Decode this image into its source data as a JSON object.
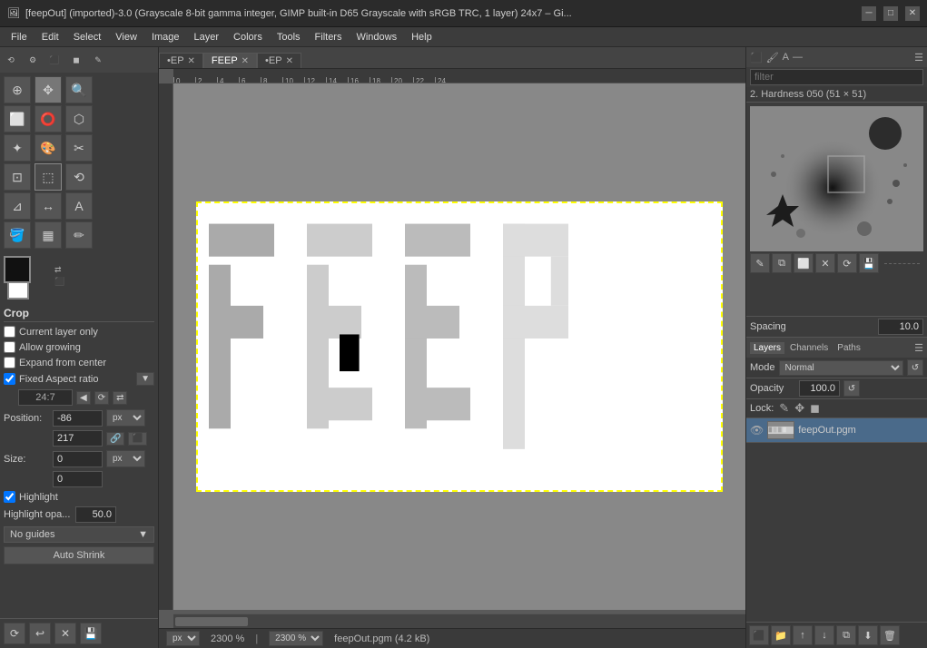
{
  "window": {
    "title": "[feepOut] (imported)-3.0 (Grayscale 8-bit gamma integer, GIMP built-in D65 Grayscale with sRGB TRC, 1 layer) 24x7 – Gi...",
    "minimize": "─",
    "restore": "□",
    "close": "✕",
    "icon": "🖼"
  },
  "menubar": {
    "items": [
      "File",
      "Edit",
      "Select",
      "View",
      "Image",
      "Layer",
      "Colors",
      "Tools",
      "Filters",
      "Windows",
      "Help"
    ]
  },
  "image_tabs": [
    {
      "label": "•EP",
      "active": false
    },
    {
      "label": "FEEP",
      "active": true
    },
    {
      "label": "•EP",
      "active": false
    }
  ],
  "tools": {
    "grid": [
      "⊕",
      "⬡",
      "⌀",
      "✎",
      "✂",
      "⊡",
      "⟲",
      "★",
      "→",
      "⬛",
      "✏",
      "⬚",
      "🖋",
      "✦",
      "A",
      "🔍"
    ]
  },
  "crop_options": {
    "section_title": "Crop",
    "current_layer_only": "Current layer only",
    "allow_growing": "Allow growing",
    "expand_from_center": "Expand from center",
    "fixed_aspect_ratio": "Fixed Aspect ratio",
    "crop_ratio": "24:7",
    "position_label": "Position:",
    "position_unit": "px",
    "position_x": "-86",
    "position_y": "217",
    "size_label": "Size:",
    "size_unit": "px",
    "size_x": "0",
    "size_y": "0",
    "highlight_label": "Highlight",
    "highlight_opa_label": "Highlight opa...",
    "highlight_opa_value": "50.0",
    "guides_label": "No guides",
    "auto_shrink_label": "Auto Shrink"
  },
  "canvas": {
    "zoom_level": "2300 %",
    "zoom_unit": "px",
    "filename": "feepOut.pgm (4.2 kB)"
  },
  "brush_panel": {
    "name_label": "2. Hardness 050 (51 × 51)",
    "filter_placeholder": "filter",
    "spacing_label": "Spacing",
    "spacing_value": "10.0"
  },
  "layers_panel": {
    "tabs": [
      "Layers",
      "Channels",
      "Paths"
    ],
    "active_tab": "Layers",
    "mode_label": "Mode",
    "mode_value": "Normal",
    "opacity_label": "Opacity",
    "opacity_value": "100.0",
    "lock_label": "Lock:",
    "layer_name": "feepOut.pgm"
  }
}
